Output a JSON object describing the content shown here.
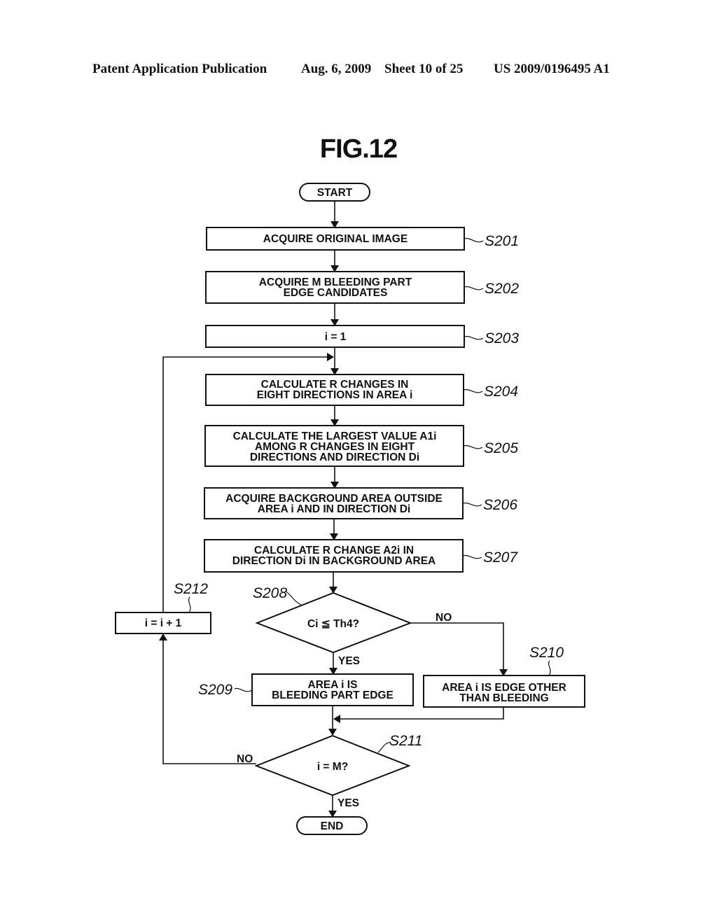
{
  "header": {
    "publication": "Patent Application Publication",
    "date": "Aug. 6, 2009",
    "sheet": "Sheet 10 of 25",
    "number": "US 2009/0196495 A1"
  },
  "figure_title": "FIG.12",
  "flowchart": {
    "start": "START",
    "end": "END",
    "steps": {
      "S201": {
        "label": "S201",
        "lines": [
          "ACQUIRE ORIGINAL IMAGE"
        ]
      },
      "S202": {
        "label": "S202",
        "lines": [
          "ACQUIRE M BLEEDING PART",
          "EDGE CANDIDATES"
        ]
      },
      "S203": {
        "label": "S203",
        "lines": [
          "i = 1"
        ]
      },
      "S204": {
        "label": "S204",
        "lines": [
          "CALCULATE R CHANGES IN",
          "EIGHT DIRECTIONS IN AREA i"
        ]
      },
      "S205": {
        "label": "S205",
        "lines": [
          "CALCULATE THE LARGEST VALUE A1i",
          "AMONG R CHANGES IN EIGHT",
          "DIRECTIONS AND DIRECTION Di"
        ]
      },
      "S206": {
        "label": "S206",
        "lines": [
          "ACQUIRE BACKGROUND AREA OUTSIDE",
          "AREA i AND IN DIRECTION Di"
        ]
      },
      "S207": {
        "label": "S207",
        "lines": [
          "CALCULATE R CHANGE A2i IN",
          "DIRECTION Di IN BACKGROUND AREA"
        ]
      },
      "S208": {
        "label": "S208",
        "lines": [
          "Ci ≦ Th4?"
        ]
      },
      "S209": {
        "label": "S209",
        "lines": [
          "AREA i IS",
          "BLEEDING PART EDGE"
        ]
      },
      "S210": {
        "label": "S210",
        "lines": [
          "AREA i IS EDGE OTHER",
          "THAN BLEEDING"
        ]
      },
      "S211": {
        "label": "S211",
        "lines": [
          "i = M?"
        ]
      },
      "S212": {
        "label": "S212",
        "lines": [
          "i = i + 1"
        ]
      }
    },
    "branches": {
      "s208_yes": "YES",
      "s208_no": "NO",
      "s211_yes": "YES",
      "s211_no": "NO"
    }
  }
}
